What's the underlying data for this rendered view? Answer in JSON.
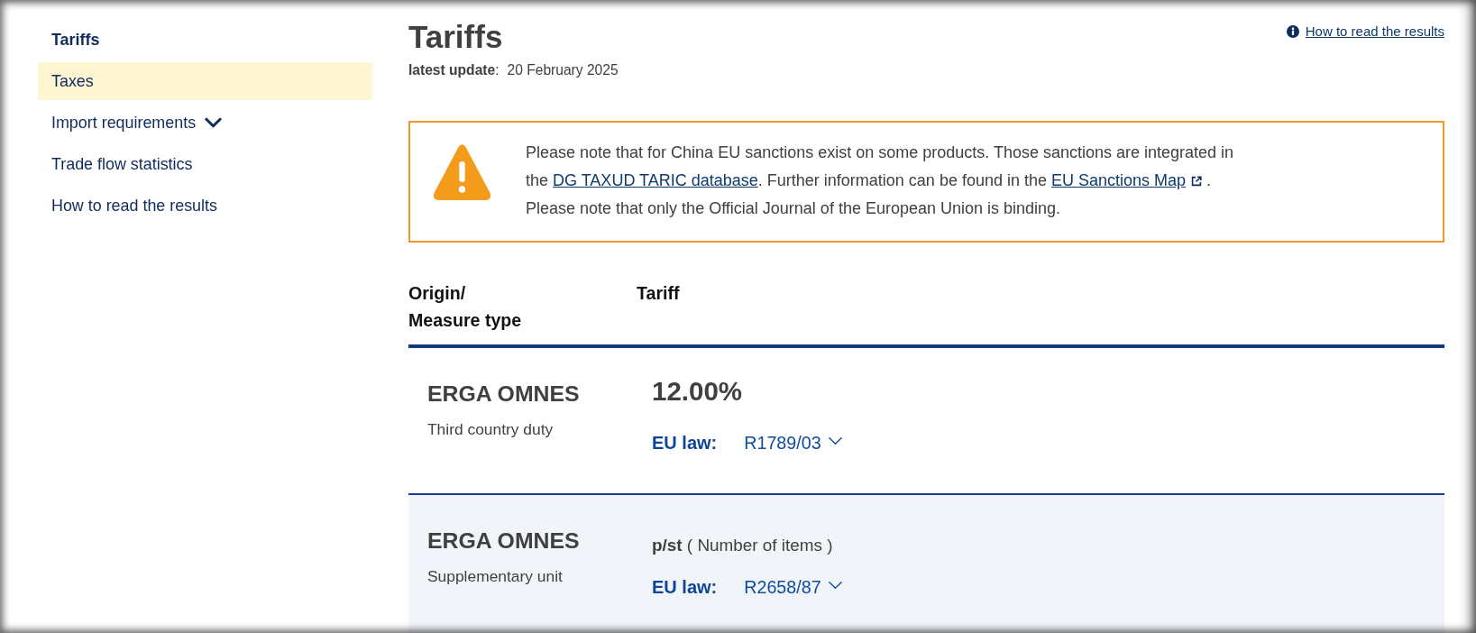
{
  "sidebar": {
    "items": [
      {
        "label": "Tariffs",
        "kind": "link",
        "selected": true,
        "hovered": false
      },
      {
        "label": "Taxes",
        "kind": "link",
        "selected": false,
        "hovered": true
      },
      {
        "label": "Import requirements",
        "kind": "group",
        "selected": false,
        "hovered": false,
        "expanded": false
      },
      {
        "label": "Trade flow statistics",
        "kind": "link",
        "selected": false,
        "hovered": false
      },
      {
        "label": "How to read the results",
        "kind": "link",
        "selected": false,
        "hovered": false
      }
    ]
  },
  "header": {
    "title": "Tariffs",
    "update_label": "**latest update**:",
    "update_value": "20 February 2025",
    "help_link": "How to read the results"
  },
  "notice": {
    "kind": "warning",
    "paragraphs": [
      [
        {
          "kind": "text",
          "text": "Please note that for China EU sanctions exist on some products. Those sanctions are integrated in the "
        },
        {
          "kind": "link",
          "text": "DG TAXUD TARIC database",
          "external": false
        },
        {
          "kind": "text",
          "text": ". Further information can be found in the "
        },
        {
          "kind": "link",
          "text": "EU Sanctions Map",
          "external": true
        },
        {
          "kind": "text",
          "text": " ."
        }
      ],
      [
        {
          "kind": "text",
          "text": "Please note that only the Official Journal of the European Union is binding."
        }
      ]
    ]
  },
  "table": {
    "columns": [
      "Origin/ Measure type",
      "Tariff"
    ],
    "rows": [
      {
        "origin": "ERGA OMNES",
        "measure": "Third country duty",
        "tariff": {
          "kind": "rate",
          "text": "12.00%"
        },
        "law_label": "EU law:",
        "law": "R1789/03",
        "expanded": false
      },
      {
        "origin": "ERGA OMNES",
        "measure": "Supplementary unit",
        "tariff": {
          "kind": "unit",
          "text": "**p/st** ( Number of items )"
        },
        "law_label": "EU law:",
        "law": "R2658/87",
        "expanded": false
      }
    ]
  }
}
